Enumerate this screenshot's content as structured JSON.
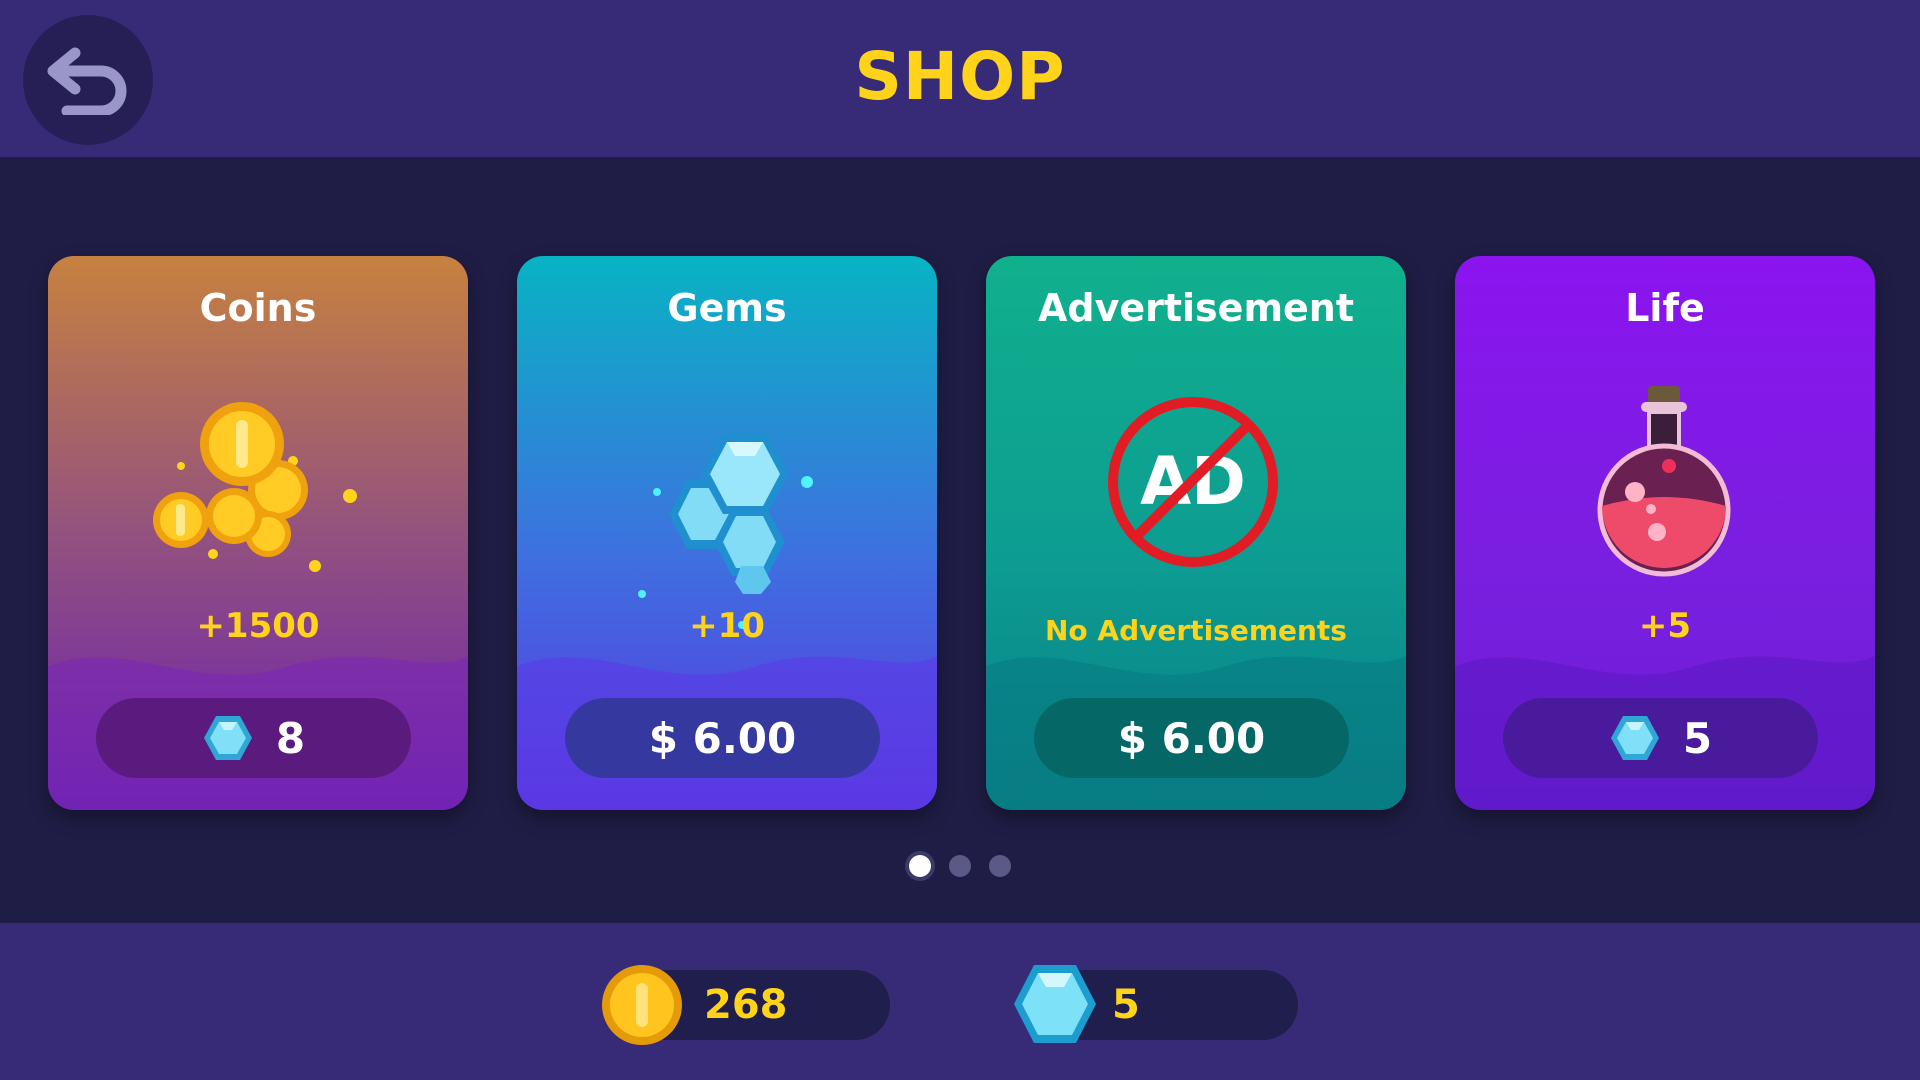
{
  "header": {
    "title": "SHOP",
    "back_icon": "back-arrow-icon"
  },
  "colors": {
    "accent_yellow": "#ffd31a",
    "header_bg": "#372b78",
    "page_bg": "#1f1d45"
  },
  "cards": [
    {
      "title": "Coins",
      "art_icon": "coin-pile-icon",
      "amount": "+1500",
      "price_icon": "gem-icon",
      "price": "8"
    },
    {
      "title": "Gems",
      "art_icon": "gem-cluster-icon",
      "amount": "+10",
      "price_icon": "",
      "price": "$ 6.00"
    },
    {
      "title": "Advertisement",
      "art_icon": "no-ads-icon",
      "art_text": "AD",
      "amount": "No Advertisements",
      "price_icon": "",
      "price": "$ 6.00"
    },
    {
      "title": "Life",
      "art_icon": "potion-icon",
      "amount": "+5",
      "price_icon": "gem-icon",
      "price": "5"
    }
  ],
  "pagination": {
    "pages": 3,
    "active": 1
  },
  "wallet": {
    "coins": {
      "icon": "coin-icon",
      "value": "268"
    },
    "gems": {
      "icon": "gem-icon",
      "value": "5"
    }
  }
}
